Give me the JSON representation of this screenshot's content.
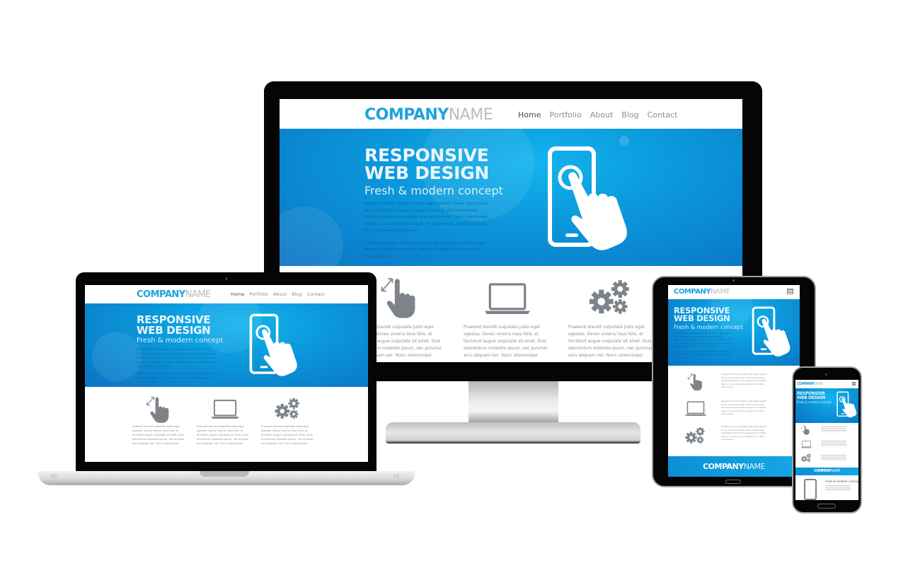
{
  "site": {
    "logo_bold": "COMPANY",
    "logo_light": "NAME",
    "nav": [
      {
        "label": "Home",
        "active": true
      },
      {
        "label": "Portfolio",
        "active": false
      },
      {
        "label": "About",
        "active": false
      },
      {
        "label": "Blog",
        "active": false
      },
      {
        "label": "Contact",
        "active": false
      }
    ],
    "hero": {
      "title_line1": "RESPONSIVE",
      "title_line2": "WEB DESIGN",
      "subtitle": "Fresh & modern concept",
      "body_p1": "Praesent blandit vulputate justo eget egestas. Donec viverra risus felis, at tincidunt augue vulputate sit amet. Duis elementum molestie ipsum, nec pulvinar arcu aliquam nec. Nunc ullamcorper neque a purus tristique congue. In lorem neque, facilisis posuere enim id, varius auctor lorem.",
      "body_p2": "Curabitur dui nisi, vehicula sed sem vel, placerat egestas neque. Aenean ut metus vel metus dignissim aliquet. Mauris gravida ullamcorper orci."
    },
    "features": [
      {
        "icon": "pinch-hand-icon",
        "text": "Praesent blandit vulputate justo eget egestas. Donec viverra risus felis, at tincidunt augue vulputate sit amet. Duis elementum molestie ipsum, nec pulvinar arcu aliquam nec. Nunc ullamcorper"
      },
      {
        "icon": "laptop-icon",
        "text": "Praesent blandit vulputate justo eget egestas. Donec viverra risus felis, at tincidunt augue vulputate sit amet. Duis elementum molestie ipsum, nec pulvinar arcu aliquam nec. Nunc ullamcorper"
      },
      {
        "icon": "gears-icon",
        "text": "Praesent blandit vulputate justo eget egestas. Donec viverra risus felis, at tincidunt augue vulputate sit amet. Duis elementum molestie ipsum, nec pulvinar arcu aliquam nec. Nunc ullamcorper"
      }
    ],
    "footer_logo_bold": "COMPANY",
    "footer_logo_light": "NAME",
    "phone_extra_heading": "Fresh & modern concept",
    "colors": {
      "brand_blue": "#1ea2de",
      "hero_blue": "#0b95d9",
      "icon_gray": "#7d8388",
      "bezel": "#050505"
    }
  },
  "devices": [
    "desktop-monitor",
    "laptop",
    "tablet",
    "smartphone"
  ]
}
